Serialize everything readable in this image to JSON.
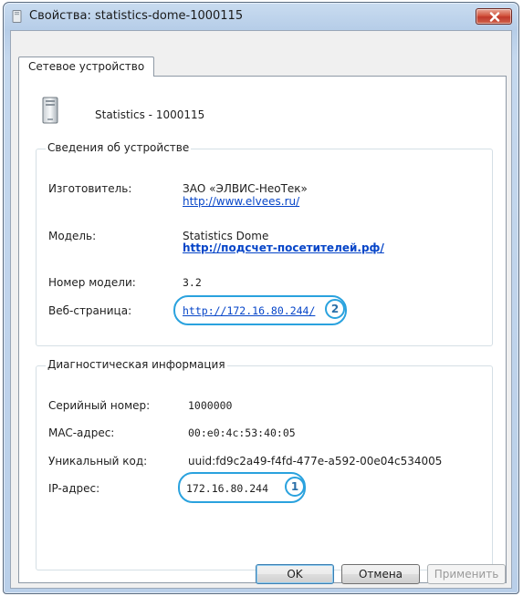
{
  "window": {
    "title": "Свойства: statistics-dome-1000115"
  },
  "tabs": [
    {
      "label": "Сетевое устройство",
      "active": true
    }
  ],
  "device": {
    "name": "Statistics - 1000115",
    "icon": "computer-tower-icon"
  },
  "device_info": {
    "title": "Сведения об устройстве",
    "manufacturer_label": "Изготовитель:",
    "manufacturer_name": "ЗАО «ЭЛВИС-НеоТек»",
    "manufacturer_link": "http://www.elvees.ru/",
    "model_label": "Модель:",
    "model_name": "Statistics Dome",
    "model_link": "http://подсчет-посетителей.рф/",
    "model_number_label": "Номер модели:",
    "model_number": "3.2",
    "webpage_label": "Веб-страница:",
    "webpage_link": "http://172.16.80.244/"
  },
  "diagnostics": {
    "title": "Диагностическая информация",
    "serial_label": "Серийный номер:",
    "serial": "1000000",
    "mac_label": "MAC-адрес:",
    "mac": "00:e0:4c:53:40:05",
    "uid_label": "Уникальный код:",
    "uid": "uuid:fd9c2a49-f4fd-477e-a592-00e04c534005",
    "ip_label": "IP-адрес:",
    "ip": "172.16.80.244"
  },
  "callouts": {
    "ip": "1",
    "webpage": "2",
    "color": "#2aa2de"
  },
  "buttons": {
    "ok": "OK",
    "cancel": "Отмена",
    "apply": "Применить",
    "apply_enabled": false
  }
}
